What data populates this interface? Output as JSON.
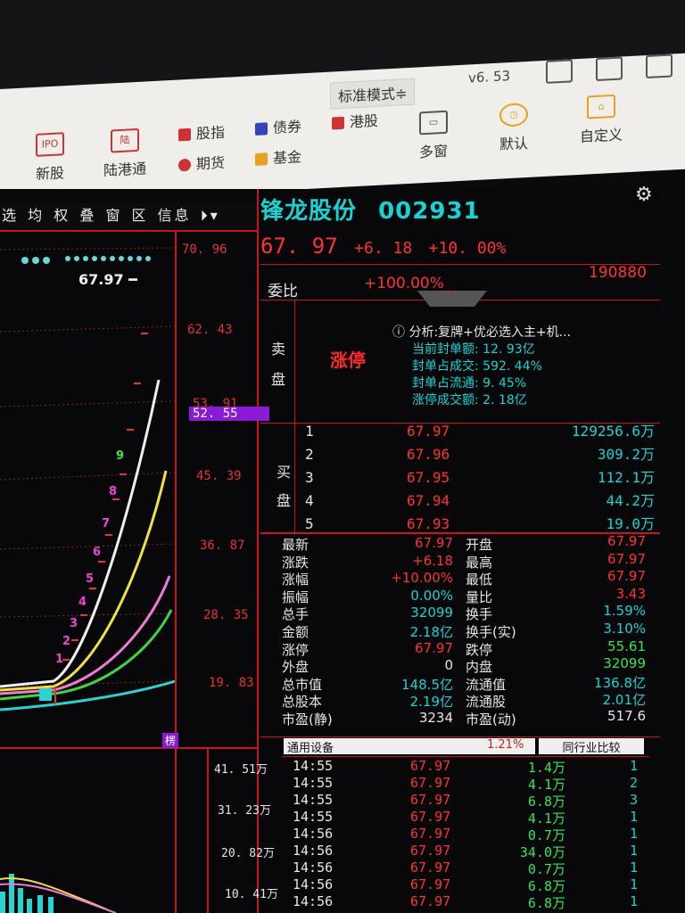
{
  "toolbar": {
    "mode": "标准模式≑",
    "version": "v6. 53",
    "buttons": [
      "新股",
      "陆港通"
    ],
    "small": [
      "股指",
      "债券",
      "港股",
      "期货",
      "基金"
    ],
    "views": [
      "多窗",
      "默认",
      "自定义"
    ]
  },
  "menu": [
    "选",
    "均",
    "权",
    "叠",
    "窗",
    "区",
    "信息"
  ],
  "stock": {
    "name": "锋龙股份",
    "code": "002931",
    "price": "67. 97",
    "change": "+6. 18",
    "pct": "+10. 00%"
  },
  "price_axis": [
    "70. 96",
    "62. 43",
    "53. 91",
    "52. 55",
    "45. 39",
    "36. 87",
    "28. 35",
    "19. 83"
  ],
  "vol_axis": [
    "41. 51万",
    "31. 23万",
    "20. 82万",
    "10. 41万"
  ],
  "chart_label": "67.97",
  "seq": [
    "1",
    "2",
    "3",
    "4",
    "5",
    "6",
    "7",
    "8",
    "9"
  ],
  "weibi": {
    "label": "委比",
    "value": "+100.00%",
    "num": "190880"
  },
  "sell": {
    "l1": "卖",
    "l2": "盘",
    "status": "涨停"
  },
  "analysis": [
    "分析:复牌+优必选入主+机...",
    "当前封单额: 12. 93亿",
    "封单占成交: 592. 44%",
    "封单占流通: 9. 45%",
    "涨停成交额: 2. 18亿"
  ],
  "buy": {
    "l1": "买",
    "l2": "盘",
    "rows": [
      {
        "n": "1",
        "p": "67.97",
        "v": "129256.6万"
      },
      {
        "n": "2",
        "p": "67.96",
        "v": "309.2万"
      },
      {
        "n": "3",
        "p": "67.95",
        "v": "112.1万"
      },
      {
        "n": "4",
        "p": "67.94",
        "v": "44.2万"
      },
      {
        "n": "5",
        "p": "67.93",
        "v": "19.0万"
      }
    ]
  },
  "stats": [
    {
      "l": "最新",
      "v": "67.97",
      "c": "red",
      "l2": "开盘",
      "v2": "67.97",
      "c2": "red"
    },
    {
      "l": "涨跌",
      "v": "+6.18",
      "c": "red",
      "l2": "最高",
      "v2": "67.97",
      "c2": "red"
    },
    {
      "l": "涨幅",
      "v": "+10.00%",
      "c": "red",
      "l2": "最低",
      "v2": "67.97",
      "c2": "red"
    },
    {
      "l": "振幅",
      "v": "0.00%",
      "c": "cyan",
      "l2": "量比",
      "v2": "3.43",
      "c2": "red"
    },
    {
      "l": "总手",
      "v": "32099",
      "c": "cyan",
      "l2": "换手",
      "v2": "1.59%",
      "c2": "cyan"
    },
    {
      "l": "金额",
      "v": "2.18亿",
      "c": "cyan",
      "l2": "换手(实)",
      "v2": "3.10%",
      "c2": "cyan"
    },
    {
      "l": "涨停",
      "v": "67.97",
      "c": "red",
      "l2": "跌停",
      "v2": "55.61",
      "c2": "grn"
    },
    {
      "l": "外盘",
      "v": "0",
      "c": "wht",
      "l2": "内盘",
      "v2": "32099",
      "c2": "grn"
    },
    {
      "l": "总市值",
      "v": "148.5亿",
      "c": "cyan",
      "l2": "流通值",
      "v2": "136.8亿",
      "c2": "cyan"
    },
    {
      "l": "总股本",
      "v": "2.19亿",
      "c": "cyan",
      "l2": "流通股",
      "v2": "2.01亿",
      "c2": "cyan"
    },
    {
      "l": "市盈(静)",
      "v": "3234",
      "c": "wht",
      "l2": "市盈(动)",
      "v2": "517.6",
      "c2": "wht"
    }
  ],
  "industry": {
    "name": "通用设备",
    "pct": "1.21%",
    "btn": "同行业比较"
  },
  "ticks": [
    {
      "t": "14:55",
      "p": "67.97",
      "v": "1.4万",
      "n": "1"
    },
    {
      "t": "14:55",
      "p": "67.97",
      "v": "4.1万",
      "n": "2"
    },
    {
      "t": "14:55",
      "p": "67.97",
      "v": "6.8万",
      "n": "3"
    },
    {
      "t": "14:55",
      "p": "67.97",
      "v": "4.1万",
      "n": "1"
    },
    {
      "t": "14:56",
      "p": "67.97",
      "v": "0.7万",
      "n": "1"
    },
    {
      "t": "14:56",
      "p": "67.97",
      "v": "34.0万",
      "n": "1"
    },
    {
      "t": "14:56",
      "p": "67.97",
      "v": "0.7万",
      "n": "1"
    },
    {
      "t": "14:56",
      "p": "67.97",
      "v": "6.8万",
      "n": "1"
    },
    {
      "t": "14:56",
      "p": "67.97",
      "v": "6.8万",
      "n": "1"
    }
  ],
  "side_tag": "楞"
}
